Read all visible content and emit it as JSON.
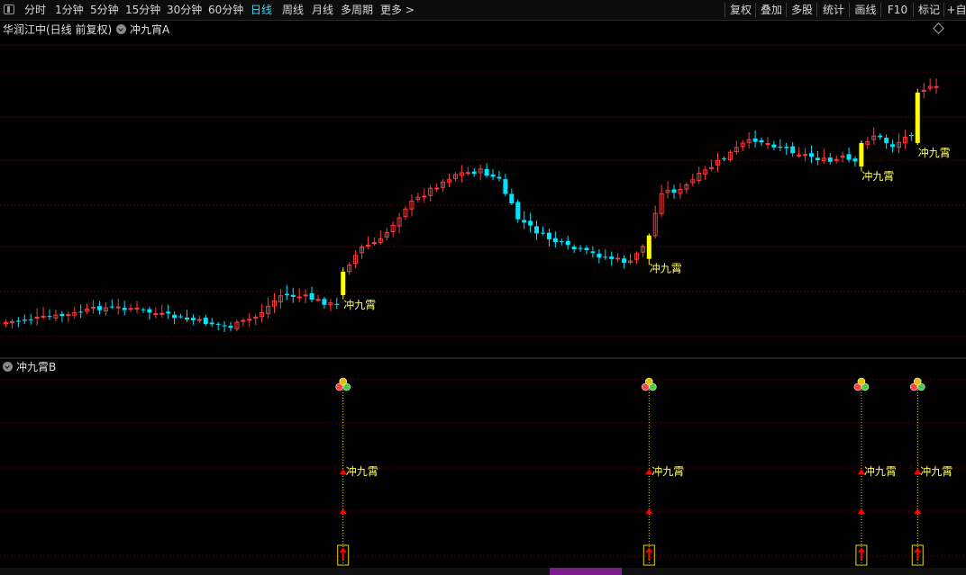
{
  "toolbar": {
    "periods": [
      "分时",
      "1分钟",
      "5分钟",
      "15分钟",
      "30分钟",
      "60分钟",
      "日线",
      "周线",
      "月线",
      "多周期",
      "更多 >"
    ],
    "active_period": "日线",
    "right_buttons": [
      "复权",
      "叠加",
      "多股",
      "统计",
      "画线",
      "F10",
      "标记",
      "+自"
    ]
  },
  "main_chart": {
    "title": "华润江中(日线 前复权)",
    "indicator_name": "冲九宵A",
    "signal_label": "冲九霄"
  },
  "sub_chart": {
    "indicator_name": "冲九霄B",
    "signal_label": "冲九霄"
  },
  "colors": {
    "up": "#ff3b3b",
    "down": "#00e5ff",
    "signal": "#ffff00",
    "grid": "#5a0000",
    "arrow": "#ff0000"
  },
  "chart_data": {
    "type": "candlestick",
    "series": "华润江中 日线 前复权",
    "bar_count": 150,
    "signal_bars": [
      54,
      103,
      137,
      146
    ],
    "signal_text": "冲九霄"
  }
}
